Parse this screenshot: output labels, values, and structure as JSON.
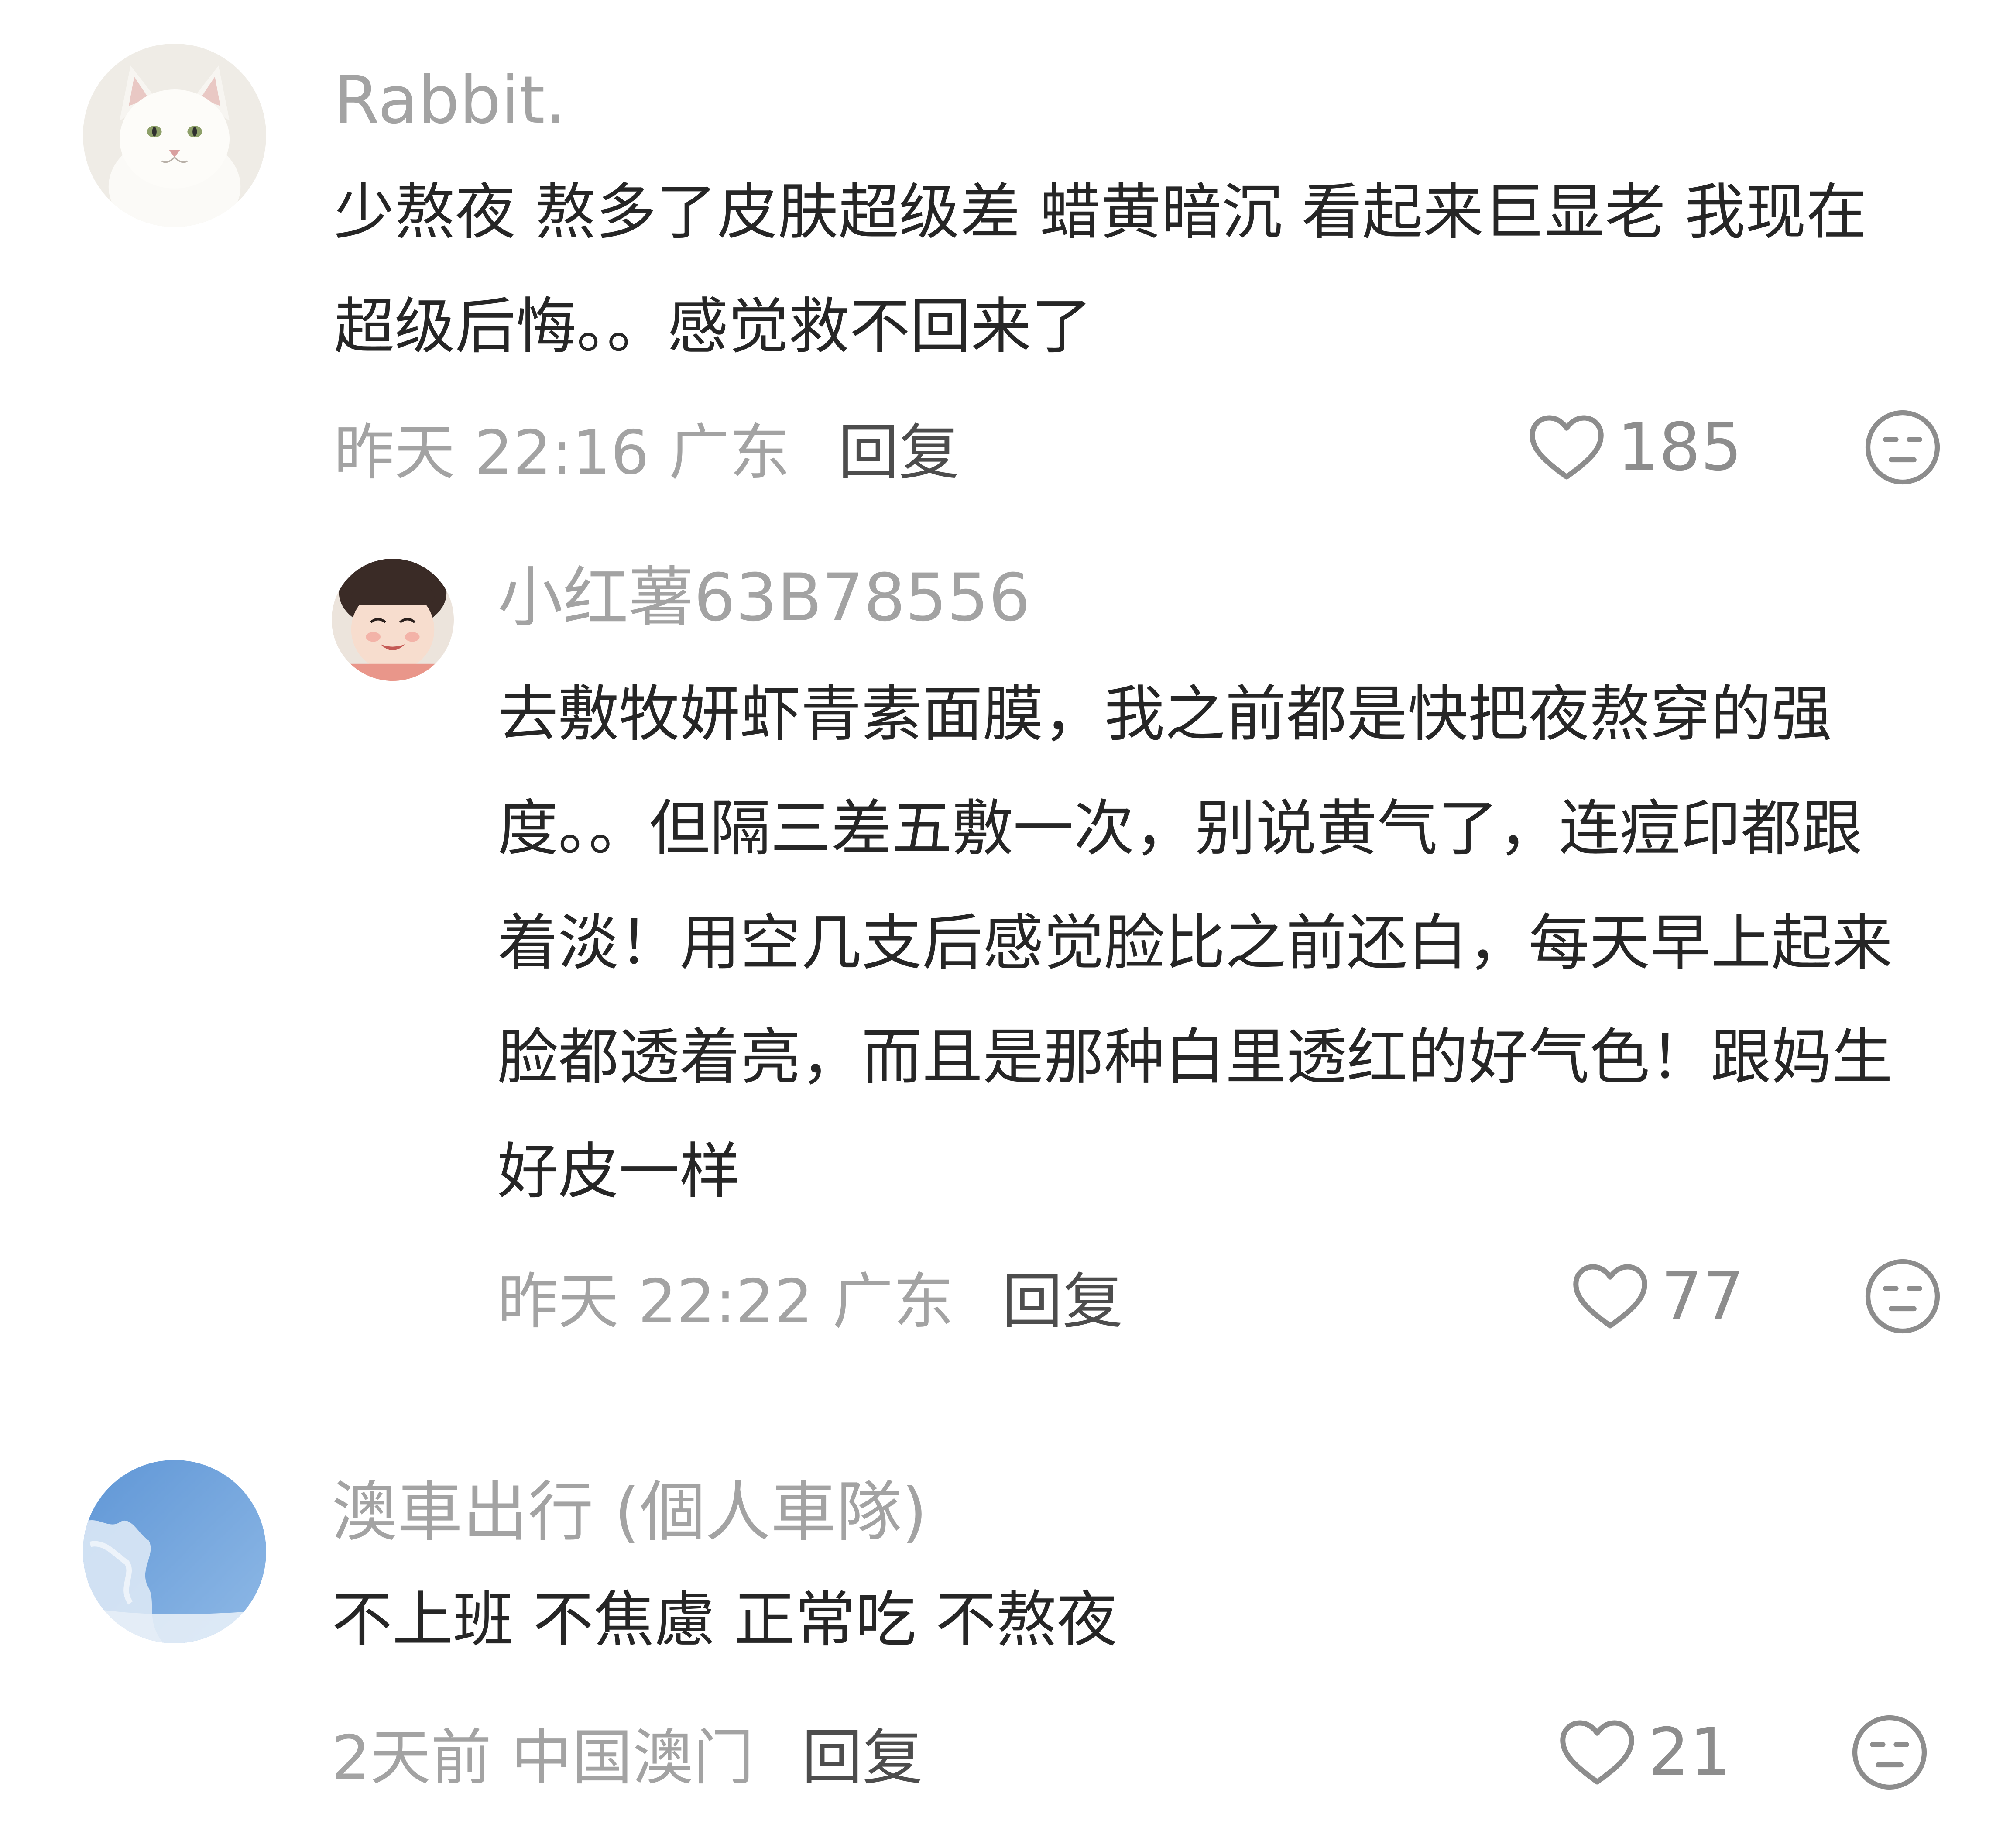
{
  "comments": [
    {
      "username": "Rabbit.",
      "text": "少熬夜 熬多了皮肤超级差 蜡黄暗沉 看起来巨显老 我现在超级后悔。。感觉救不回来了",
      "time": "昨天 22:16",
      "location": "广东",
      "reply_label": "回复",
      "likes": "185",
      "avatar_icon": "white-cat-avatar",
      "reply": {
        "username": "小红薯63B78556",
        "text": "去敷牧妍虾青素面膜，我之前都是快把夜熬穿的强度。。但隔三差五敷一次，别说黄气了，连痘印都跟着淡！用空几支后感觉脸比之前还白，每天早上起来脸都透着亮，而且是那种白里透红的好气色！跟妈生好皮一样",
        "time": "昨天 22:22",
        "location": "广东",
        "reply_label": "回复",
        "likes": "77",
        "avatar_icon": "child-avatar"
      }
    },
    {
      "username": "澳車出行 (個人車隊)",
      "text": "不上班 不焦慮 正常吃 不熬夜",
      "time": "2天前",
      "location": "中国澳门",
      "reply_label": "回复",
      "likes": "21",
      "avatar_icon": "sky-clouds-avatar"
    }
  ],
  "icons": {
    "like": "heart-outline-icon",
    "dislike": "unamused-face-icon"
  },
  "colors": {
    "username": "#a3a3a3",
    "text": "#262626",
    "meta": "#a3a3a3",
    "reply": "#4d4d4d"
  }
}
